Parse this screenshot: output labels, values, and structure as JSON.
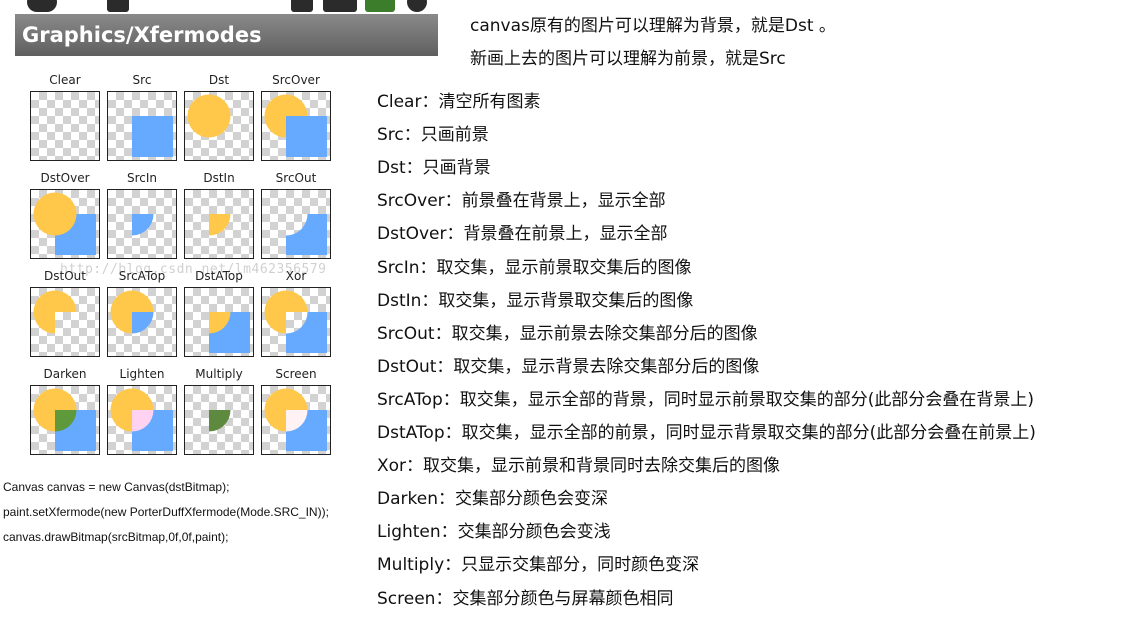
{
  "app": {
    "title": "Graphics/Xfermodes"
  },
  "modes": [
    {
      "label": "Clear",
      "kind": "clear"
    },
    {
      "label": "Src",
      "kind": "src"
    },
    {
      "label": "Dst",
      "kind": "dst"
    },
    {
      "label": "SrcOver",
      "kind": "srcover"
    },
    {
      "label": "DstOver",
      "kind": "dstover"
    },
    {
      "label": "SrcIn",
      "kind": "srcin"
    },
    {
      "label": "DstIn",
      "kind": "dstin"
    },
    {
      "label": "SrcOut",
      "kind": "srcout"
    },
    {
      "label": "DstOut",
      "kind": "dstout"
    },
    {
      "label": "SrcATop",
      "kind": "srcatop"
    },
    {
      "label": "DstATop",
      "kind": "dstatop"
    },
    {
      "label": "Xor",
      "kind": "xor"
    },
    {
      "label": "Darken",
      "kind": "darken"
    },
    {
      "label": "Lighten",
      "kind": "lighten"
    },
    {
      "label": "Multiply",
      "kind": "multiply"
    },
    {
      "label": "Screen",
      "kind": "screen"
    }
  ],
  "colors": {
    "dst_circle": "#ffc84a",
    "src_square": "#66aaff",
    "darken": "#5e9a3c",
    "lighten": "#ffd2f2",
    "multiply": "#5e8a40",
    "screen": "#fff2f4"
  },
  "code_lines": [
    "Canvas canvas = new Canvas(dstBitmap);",
    "paint.setXfermode(new PorterDuffXfermode(Mode.SRC_IN));",
    "canvas.drawBitmap(srcBitmap,0f,0f,paint);"
  ],
  "watermark": "http://blog.csdn.net/lm462356579",
  "intro": [
    "canvas原有的图片可以理解为背景，就是Dst 。",
    "新画上去的图片可以理解为前景，就是Src"
  ],
  "descriptions": [
    "Clear：清空所有图素",
    "Src：只画前景",
    "Dst：只画背景",
    "SrcOver：前景叠在背景上，显示全部",
    "DstOver：背景叠在前景上，显示全部",
    "SrcIn：取交集，显示前景取交集后的图像",
    "DstIn：取交集，显示背景取交集后的图像",
    "SrcOut：取交集，显示前景去除交集部分后的图像",
    "DstOut：取交集，显示背景去除交集部分后的图像",
    "SrcATop：取交集，显示全部的背景，同时显示前景取交集的部分(此部分会叠在背景上)",
    "DstATop：取交集，显示全部的前景，同时显示背景取交集的部分(此部分会叠在前景上)",
    "Xor：取交集，显示前景和背景同时去除交集后的图像",
    "Darken：交集部分颜色会变深",
    "Lighten：交集部分颜色会变浅",
    "Multiply：只显示交集部分，同时颜色变深",
    "Screen：交集部分颜色与屏幕颜色相同"
  ]
}
